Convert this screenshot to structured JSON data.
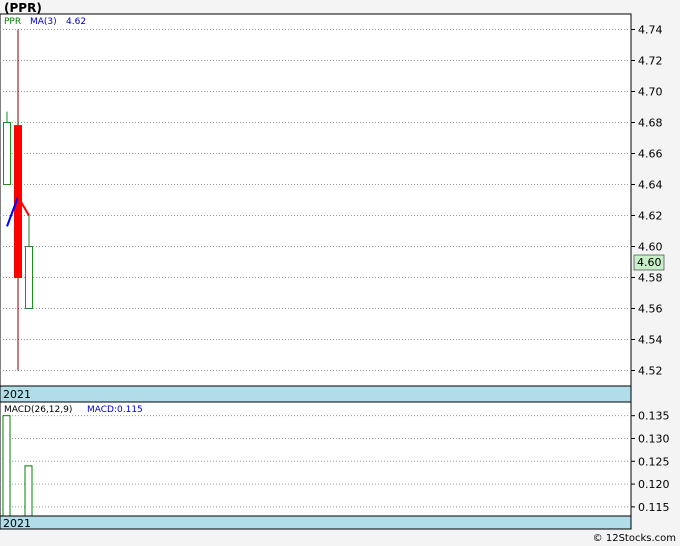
{
  "title": "(PPR)",
  "watermark": "© 12Stocks.com",
  "colors": {
    "up_candle": "#228B22",
    "down_candle": "#ff0000",
    "ma_line_1": "#0000ff",
    "ma_line_2": "#ff0000",
    "macd_bar": "#008000",
    "last_price_bg": "#c8f0c8",
    "year_band": "#b0dde8",
    "legend_ticker": "#008000",
    "legend_ma": "#0000cc"
  },
  "chart_data": [
    {
      "type": "candlestick",
      "panel": "price",
      "legend": {
        "ticker": "PPR",
        "ma_label": "MA(3)",
        "ma_value": "4.62"
      },
      "x_label": "2021",
      "ylim": [
        4.51,
        4.75
      ],
      "y_ticks": [
        "4.74",
        "4.72",
        "4.70",
        "4.68",
        "4.66",
        "4.64",
        "4.62",
        "4.60",
        "4.58",
        "4.56",
        "4.54",
        "4.52"
      ],
      "last_price": "4.60",
      "candles": [
        {
          "open": 4.64,
          "high": 4.687,
          "low": 4.64,
          "close": 4.68,
          "direction": "up"
        },
        {
          "open": 4.678,
          "high": 4.74,
          "low": 4.52,
          "close": 4.58,
          "direction": "down"
        },
        {
          "open": 4.56,
          "high": 4.62,
          "low": 4.56,
          "close": 4.6,
          "direction": "up"
        }
      ],
      "ma_values": [
        4.613,
        4.632,
        4.62
      ],
      "grid": true
    },
    {
      "type": "bar",
      "panel": "macd",
      "legend": {
        "label": "MACD(26,12,9)",
        "value_label": "MACD:0.115"
      },
      "x_label": "2021",
      "ylim": [
        0.113,
        0.138
      ],
      "y_ticks": [
        "0.135",
        "0.130",
        "0.125",
        "0.120",
        "0.115"
      ],
      "values": [
        0.135,
        null,
        0.124
      ],
      "grid": true
    }
  ]
}
